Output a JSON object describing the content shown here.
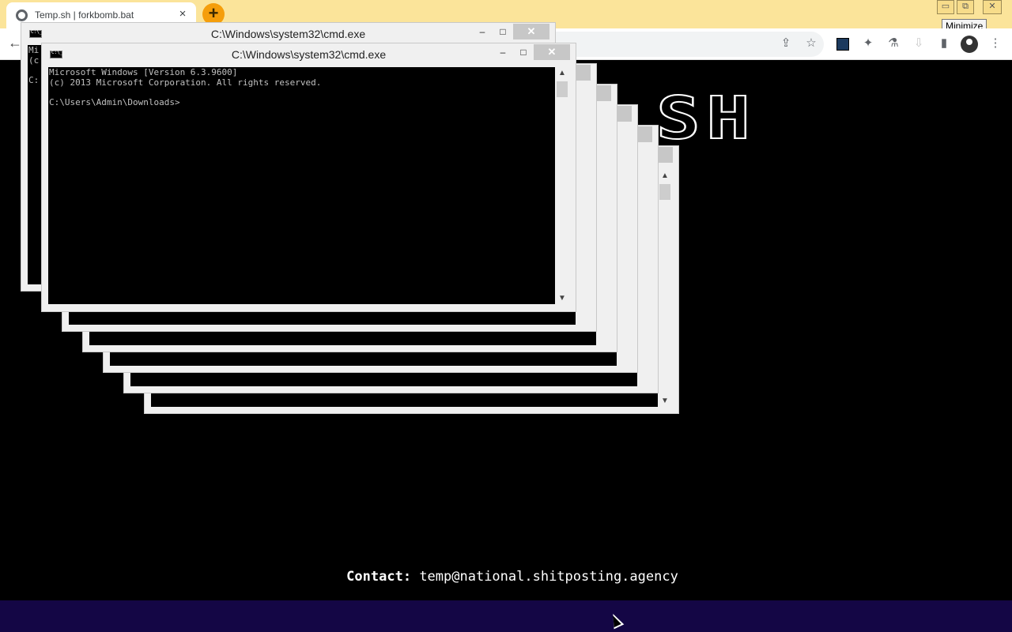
{
  "browser": {
    "tab_title": "Temp.sh | forkbomb.bat",
    "tab_close": "×",
    "new_tab": "+",
    "tooltip": "Minimize",
    "win_min": "▭",
    "win_restore": "⧉",
    "win_close": "✕",
    "back": "←",
    "icons": {
      "share": "⇪",
      "star": "☆",
      "puzzle": "✦",
      "flask": "⚗",
      "download": "⇩",
      "sidepanel": "▮",
      "menu": "⋮"
    }
  },
  "page": {
    "logo_visible": "SH",
    "contact_label": "Contact:",
    "contact_email": "temp@national.shitposting.agency",
    "footer_color": "#140645"
  },
  "cmd": {
    "title": "C:\\Windows\\system32\\cmd.exe",
    "min": "–",
    "max": "□",
    "close": "✕",
    "line1": "Microsoft Windows [Version 6.3.9600]",
    "line2": "(c) 2013 Microsoft Corporation. All rights reserved.",
    "line3": "C:\\Users\\Admin\\Downloads>",
    "back_partial_line1": "Mi",
    "back_partial_line2": "(c",
    "back_partial_line3": "C:"
  }
}
